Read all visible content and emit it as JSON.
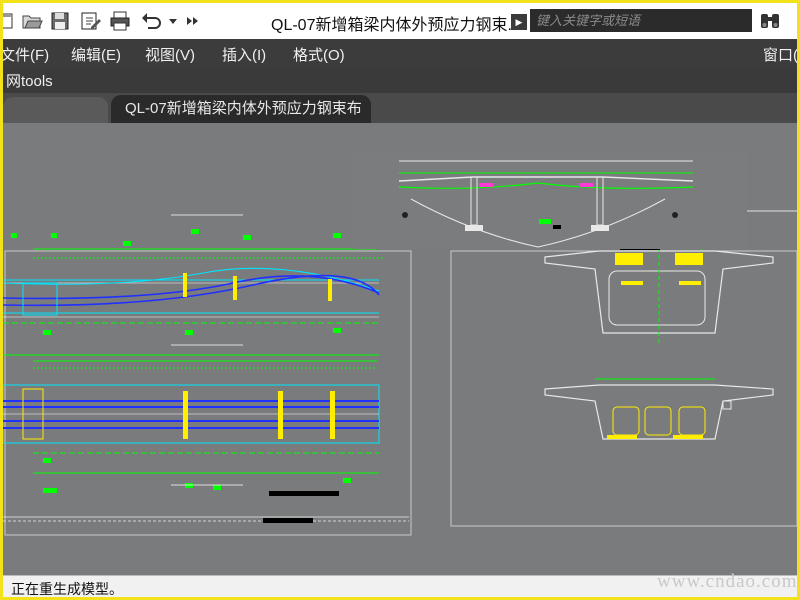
{
  "window": {
    "title": "QL-07新增箱梁内体外预应力钢束...",
    "search_placeholder": "键入关键字或短语"
  },
  "quick_access": [
    "open-icon",
    "save-icon",
    "saveas-icon",
    "print-icon",
    "undo-icon",
    "dropdown-icon",
    "more-icon"
  ],
  "menu": {
    "file": "文件(F)",
    "edit": "编辑(E)",
    "view": "视图(V)",
    "insert": "插入(I)",
    "format": "格式(O)",
    "window": "窗口("
  },
  "ribbon": {
    "tab": "网tools"
  },
  "doc_tabs": {
    "active": "QL-07新增箱梁内体外预应力钢束布"
  },
  "status": {
    "text": "正在重生成模型。"
  },
  "watermark": "www.cndao.com",
  "colors": {
    "accent_yellow": "#f3e21a",
    "cad_green": "#00ff00",
    "cad_blue": "#1d2cff",
    "cad_magenta": "#ff3bd6",
    "cad_red": "#ff2a2a",
    "cad_cyan": "#00e5ff",
    "cad_yellow": "#ffee00"
  }
}
